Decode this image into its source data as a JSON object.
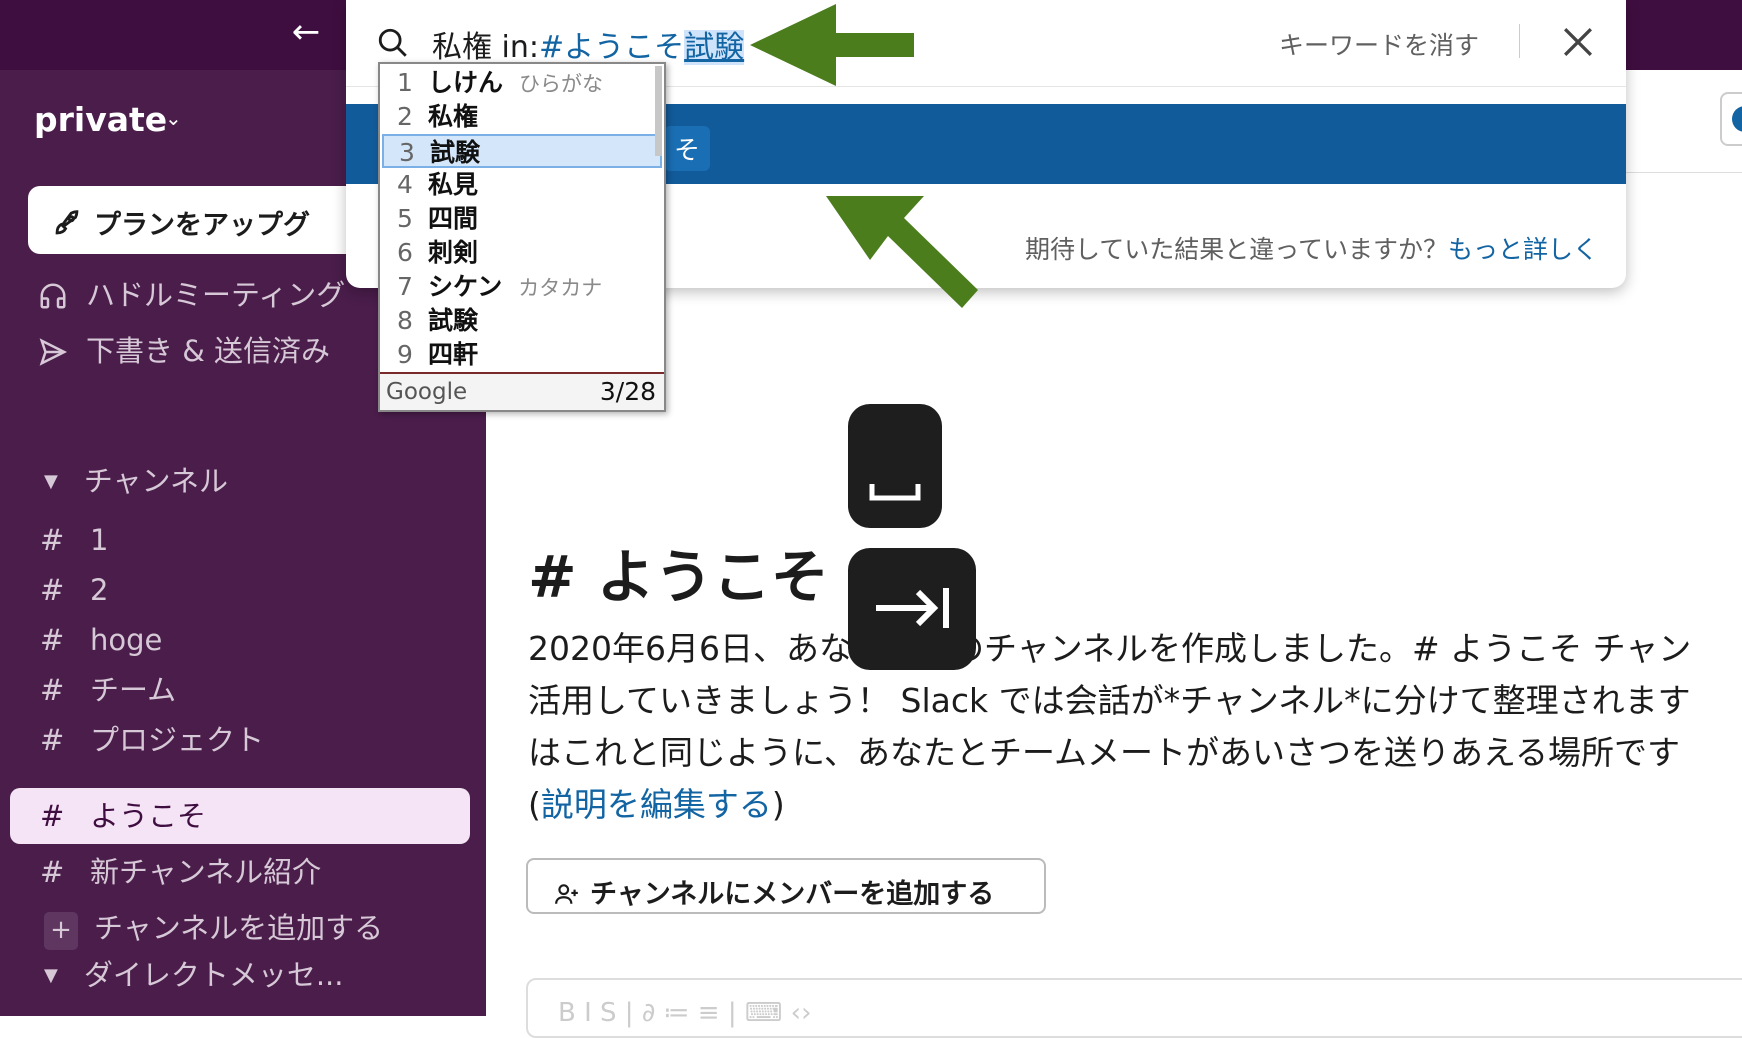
{
  "topbar": {
    "back_icon": "arrow-left-icon"
  },
  "sidebar": {
    "workspace_name": "private",
    "upgrade_label": "プランをアップグ",
    "nav": [
      {
        "label": "ハドルミーティング",
        "icon": "headphones-icon"
      },
      {
        "label": "下書き & 送信済み",
        "icon": "send-icon"
      }
    ],
    "channels_header": "チャンネル",
    "channels": [
      {
        "hash": "#",
        "name": "1"
      },
      {
        "hash": "#",
        "name": "2"
      },
      {
        "hash": "#",
        "name": "hoge"
      },
      {
        "hash": "#",
        "name": "チーム"
      },
      {
        "hash": "#",
        "name": "プロジェクト"
      },
      {
        "hash": "#",
        "name": "ようこそ",
        "active": true
      },
      {
        "hash": "#",
        "name": "新チャンネル紹介"
      }
    ],
    "add_channel_plus": "+",
    "add_channel_label": "チャンネルを追加する",
    "dm_header": "ダイレクトメッセ..."
  },
  "search": {
    "query_prefix": "私権 in:",
    "query_channel": "#ようこそ",
    "query_converting": "試験",
    "clear_label": "キーワードを消す",
    "result_fragment": "そ",
    "feedback_text": "期待していた結果と違っていますか？",
    "feedback_link": "もっと詳しく"
  },
  "ime": {
    "candidates": [
      {
        "num": "1",
        "word": "しけん",
        "hint": "ひらがな"
      },
      {
        "num": "2",
        "word": "私権",
        "hint": ""
      },
      {
        "num": "3",
        "word": "試験",
        "hint": "",
        "selected": true
      },
      {
        "num": "4",
        "word": "私見",
        "hint": ""
      },
      {
        "num": "5",
        "word": "四間",
        "hint": ""
      },
      {
        "num": "6",
        "word": "刺剣",
        "hint": ""
      },
      {
        "num": "7",
        "word": "シケン",
        "hint": "カタカナ"
      },
      {
        "num": "8",
        "word": "試験",
        "hint": ""
      },
      {
        "num": "9",
        "word": "四軒",
        "hint": ""
      }
    ],
    "brand": "Google",
    "count": "3/28"
  },
  "main": {
    "channel_title": "# ようこそ",
    "description_lines": [
      "2020年6月6日、あなたがこのチャンネルを作成しました。# ようこそ チャン",
      "活用していきましょう！ Slack では会話が*チャンネル*に分けて整理されます",
      "はこれと同じように、あなたとチームメートがあいさつを送りあえる場所です"
    ],
    "edit_open": "(",
    "edit_link": "説明を編集する",
    "edit_close": ")",
    "add_member_label": "チャンネルにメンバーを追加する",
    "composer_toolbar": "B  I  S  |  ∂  ≔  ≡  |  ⌨  ‹›"
  },
  "colors": {
    "topbar": "#3f0e40",
    "sidebar": "#4a1d4b",
    "accent_blue": "#125b9a",
    "link": "#1264a3",
    "annotation_arrow": "#4b7d1d"
  }
}
